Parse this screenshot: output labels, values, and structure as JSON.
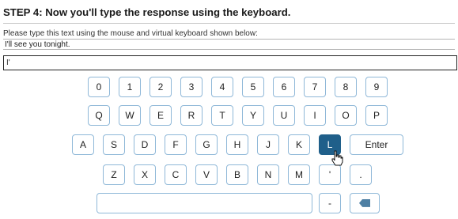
{
  "step": {
    "title": "STEP 4: Now you'll type the response using the keyboard."
  },
  "instruction": "Please type this text using the mouse and virtual keyboard shown below:",
  "target_text": "I'll see you tonight.",
  "input_value": "I'",
  "keyboard": {
    "digits": [
      "0",
      "1",
      "2",
      "3",
      "4",
      "5",
      "6",
      "7",
      "8",
      "9"
    ],
    "row1": [
      "Q",
      "W",
      "E",
      "R",
      "T",
      "Y",
      "U",
      "I",
      "O",
      "P"
    ],
    "row2": [
      "A",
      "S",
      "D",
      "F",
      "G",
      "H",
      "J",
      "K",
      "L"
    ],
    "enter_label": "Enter",
    "row3": [
      "Z",
      "X",
      "C",
      "V",
      "B",
      "N",
      "M",
      "'",
      "."
    ],
    "dash": "-",
    "space_label": "",
    "backspace_icon": "backspace-icon",
    "active_key": "L"
  },
  "colors": {
    "key_border": "#8fb8d8",
    "key_active": "#1f5f8a",
    "backspace": "#4e7fa3"
  }
}
